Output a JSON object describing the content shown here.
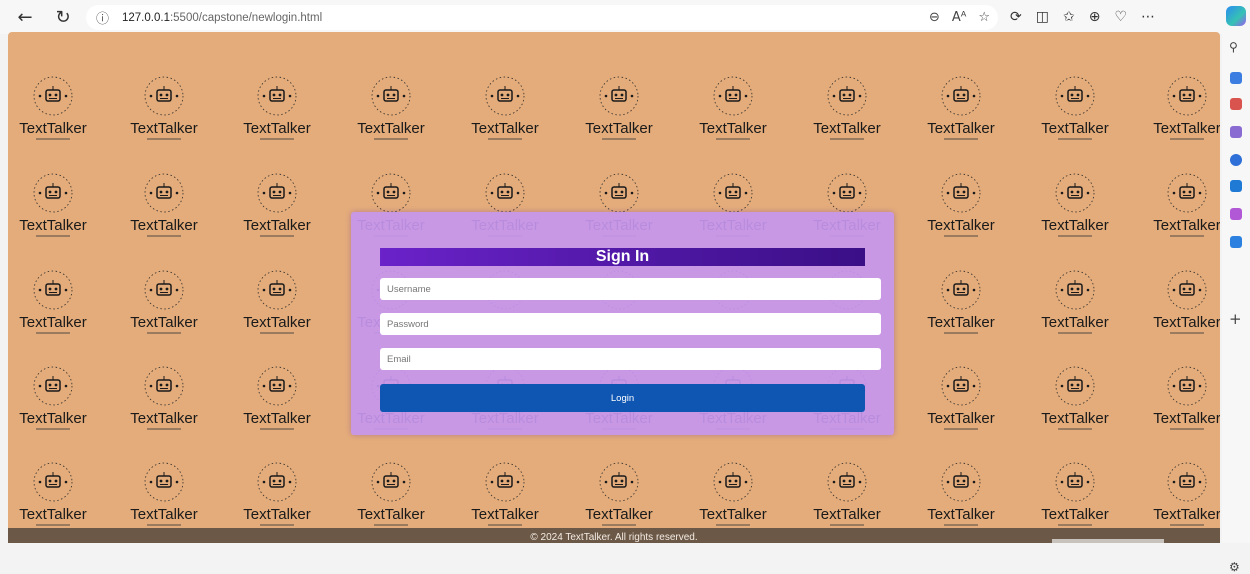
{
  "browser": {
    "address_host": "127.0.0.1",
    "address_rest": ":5500/capstone/newlogin.html",
    "back_icon": "arrow-left-icon",
    "reload_icon": "reload-icon"
  },
  "brand": {
    "name": "TextTalker"
  },
  "login": {
    "title": "Sign In",
    "username_placeholder": "Username",
    "password_placeholder": "Password",
    "email_placeholder": "Email",
    "login_label": "Login"
  },
  "footer": {
    "text": "© 2024 TextTalker. All rights reserved."
  },
  "colors": {
    "page_bg": "#e4ac7a",
    "modal_bg": "#c696ee",
    "title_bar": "#6a22c9",
    "login_button": "#0f56b3",
    "footer_bg": "#6c5847"
  }
}
